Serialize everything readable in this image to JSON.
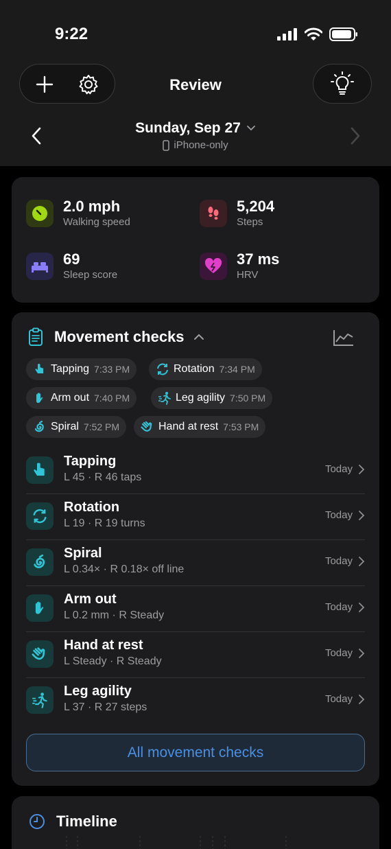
{
  "status": {
    "time": "9:22"
  },
  "header": {
    "title": "Review",
    "date": "Sunday, Sep 27",
    "source": "iPhone-only"
  },
  "metrics": [
    {
      "value": "2.0 mph",
      "label": "Walking speed",
      "icon": "walking-speed-icon",
      "color": "#a0d911"
    },
    {
      "value": "5,204",
      "label": "Steps",
      "icon": "footprints-icon",
      "color": "#ff6b7a"
    },
    {
      "value": "69",
      "label": "Sleep score",
      "icon": "bed-icon",
      "color": "#8a7dff"
    },
    {
      "value": "37 ms",
      "label": "HRV",
      "icon": "heart-pulse-icon",
      "color": "#e040c8"
    }
  ],
  "movement": {
    "title": "Movement checks",
    "chips": [
      {
        "label": "Tapping",
        "time": "7:33 PM"
      },
      {
        "label": "Rotation",
        "time": "7:34 PM"
      },
      {
        "label": "Arm out",
        "time": "7:40 PM"
      },
      {
        "label": "Leg agility",
        "time": "7:50 PM"
      },
      {
        "label": "Spiral",
        "time": "7:52 PM"
      },
      {
        "label": "Hand at rest",
        "time": "7:53 PM"
      }
    ],
    "rows": [
      {
        "title": "Tapping",
        "sub": "L 45 · R 46 taps",
        "when": "Today"
      },
      {
        "title": "Rotation",
        "sub": "L 19 · R 19 turns",
        "when": "Today"
      },
      {
        "title": "Spiral",
        "sub": "L 0.34× · R 0.18× off line",
        "when": "Today"
      },
      {
        "title": "Arm out",
        "sub": "L 0.2 mm · R Steady",
        "when": "Today"
      },
      {
        "title": "Hand at rest",
        "sub": "L Steady · R Steady",
        "when": "Today"
      },
      {
        "title": "Leg agility",
        "sub": "L 37 · R 27 steps",
        "when": "Today"
      }
    ],
    "all_button": "All movement checks"
  },
  "timeline": {
    "title": "Timeline"
  },
  "colors": {
    "accent": "#2fc4d6",
    "link": "#4a90e2"
  }
}
